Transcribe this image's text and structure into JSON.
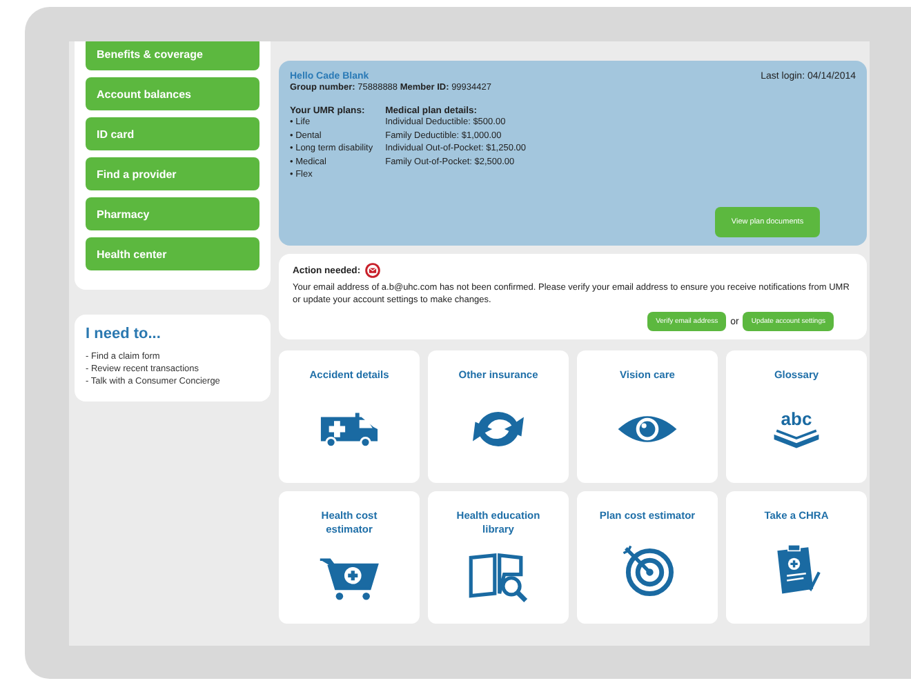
{
  "nav": [
    {
      "label": "Benefits & coverage"
    },
    {
      "label": "Account balances"
    },
    {
      "label": "ID card"
    },
    {
      "label": "Find a provider"
    },
    {
      "label": "Pharmacy"
    },
    {
      "label": "Health center"
    }
  ],
  "i_need_to": {
    "title": "I need to...",
    "items": [
      "- Find a claim form",
      "- Review recent transactions",
      "- Talk with a Consumer Concierge"
    ]
  },
  "member": {
    "greeting": "Hello Cade Blank",
    "last_login": "Last login: 04/14/2014",
    "group_label": "Group number:",
    "group_number": "75888888",
    "member_label": "Member ID:",
    "member_id": "99934427",
    "plans_title": "Your UMR plans:",
    "plans": [
      "• Life",
      "• Dental",
      "• Long term disability",
      "• Medical",
      "• Flex"
    ],
    "details_title": "Medical plan details:",
    "details": [
      "Individual Deductible: $500.00",
      "Family Deductible: $1,000.00",
      "Individual Out-of-Pocket: $1,250.00",
      "Family Out-of-Pocket: $2,500.00"
    ],
    "button": "View plan documents"
  },
  "action": {
    "title": "Action needed:",
    "message": "Your email address of a.b@uhc.com has not been confirmed. Please verify your email address to ensure you receive notifications from UMR or update your account settings to make changes.",
    "verify_button": "Verify email address",
    "or": "or",
    "update_button": "Update account settings"
  },
  "tiles": [
    {
      "label": "Accident details",
      "kind": "ambulance"
    },
    {
      "label": "Other insurance",
      "kind": "refresh"
    },
    {
      "label": "Vision care",
      "kind": "eye"
    },
    {
      "label": "Glossary",
      "kind": "abc",
      "icon_text": "abc"
    },
    {
      "label": "Health cost estimator",
      "kind": "cart"
    },
    {
      "label": "Health education library",
      "kind": "book"
    },
    {
      "label": "Plan cost estimator",
      "kind": "target"
    },
    {
      "label": "Take a CHRA",
      "kind": "clipboard"
    }
  ]
}
